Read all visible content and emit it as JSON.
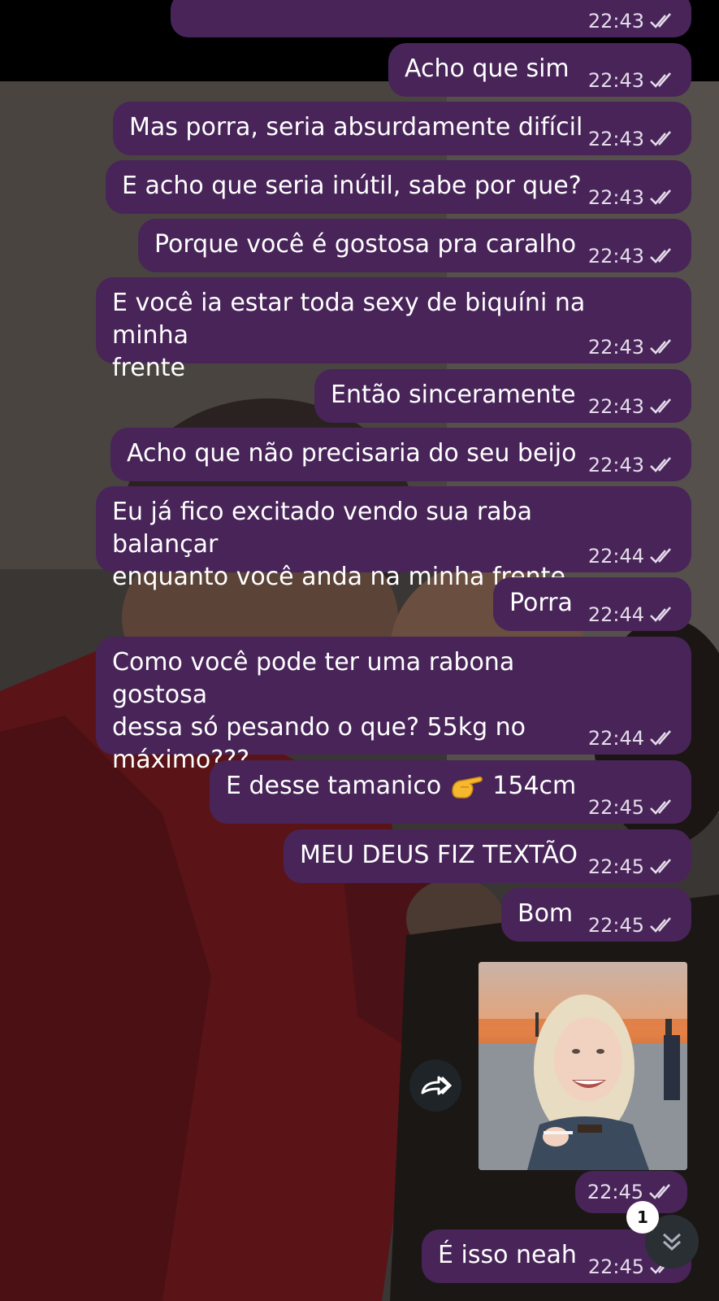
{
  "colors": {
    "bubble": "#482459",
    "meta_text": "#e5dcea",
    "bottom_button": "#2a2f33"
  },
  "messages": [
    {
      "text": "",
      "time": "22:43",
      "status": "read"
    },
    {
      "text": "Acho que sim",
      "time": "22:43",
      "status": "read"
    },
    {
      "text": "Mas porra, seria absurdamente difícil",
      "time": "22:43",
      "status": "read"
    },
    {
      "text": "E acho que seria inútil, sabe por que?",
      "time": "22:43",
      "status": "read"
    },
    {
      "text": "Porque você é gostosa pra caralho",
      "time": "22:43",
      "status": "read"
    },
    {
      "text": "E você ia estar toda sexy de biquíni na minha\nfrente",
      "time": "22:43",
      "status": "read"
    },
    {
      "text": "Então sinceramente",
      "time": "22:43",
      "status": "read"
    },
    {
      "text": "Acho que não precisaria do seu beijo",
      "time": "22:43",
      "status": "read"
    },
    {
      "text": "Eu já fico excitado vendo sua raba balançar\nenquanto você anda na minha frente",
      "time": "22:44",
      "status": "read"
    },
    {
      "text": "Porra",
      "time": "22:44",
      "status": "read"
    },
    {
      "text": "Como você pode ter uma rabona gostosa\ndessa só pesando o que? 55kg no\nmáximo???",
      "time": "22:44",
      "status": "read"
    },
    {
      "text_before": "E desse tamanico ",
      "emoji": "pointing-hand-emoji",
      "text_after": " 154cm",
      "time": "22:45",
      "status": "read"
    },
    {
      "text": "MEU DEUS FIZ TEXTÃO",
      "time": "22:45",
      "status": "read"
    },
    {
      "text": "Bom",
      "time": "22:45",
      "status": "read"
    },
    {
      "type": "photo",
      "time": "22:45",
      "status": "read"
    },
    {
      "text": "É isso neah",
      "time": "22:45",
      "status": "read"
    }
  ],
  "forward_icon": "forward-arrow-icon",
  "scroll_down": {
    "icon": "double-chevron-down-icon",
    "unread_count": "1"
  }
}
